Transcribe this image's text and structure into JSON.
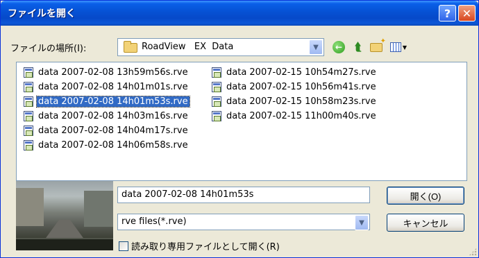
{
  "window": {
    "title": "ファイルを開く",
    "help_label": "?",
    "close_label": "✕"
  },
  "lookin": {
    "label": "ファイルの場所(I):",
    "folder": "RoadView   EX  Data"
  },
  "toolbar_icons": [
    "back-icon",
    "up-folder-icon",
    "new-folder-icon",
    "view-menu-icon"
  ],
  "files": {
    "column1": [
      "data 2007-02-08 13h59m56s.rve",
      "data 2007-02-08 14h01m01s.rve",
      "data 2007-02-08 14h01m53s.rve",
      "data 2007-02-08 14h03m16s.rve",
      "data 2007-02-08 14h04m17s.rve",
      "data 2007-02-08 14h06m58s.rve"
    ],
    "column2": [
      "data 2007-02-15 10h54m27s.rve",
      "data 2007-02-15 10h56m41s.rve",
      "data 2007-02-15 10h58m23s.rve",
      "data 2007-02-15 11h00m40s.rve"
    ],
    "selected": "data 2007-02-08 14h01m53s.rve"
  },
  "filename": {
    "value": "data 2007-02-08 14h01m53s"
  },
  "filetype": {
    "value": "rve files(*.rve)"
  },
  "buttons": {
    "open": "開く(O)",
    "cancel": "キャンセル"
  },
  "readonly": {
    "label": "読み取り専用ファイルとして開く(R)",
    "checked": false
  },
  "colors": {
    "titlebar": "#0653d6",
    "selection": "#316ac5",
    "dialog_bg": "#ece9d8"
  }
}
